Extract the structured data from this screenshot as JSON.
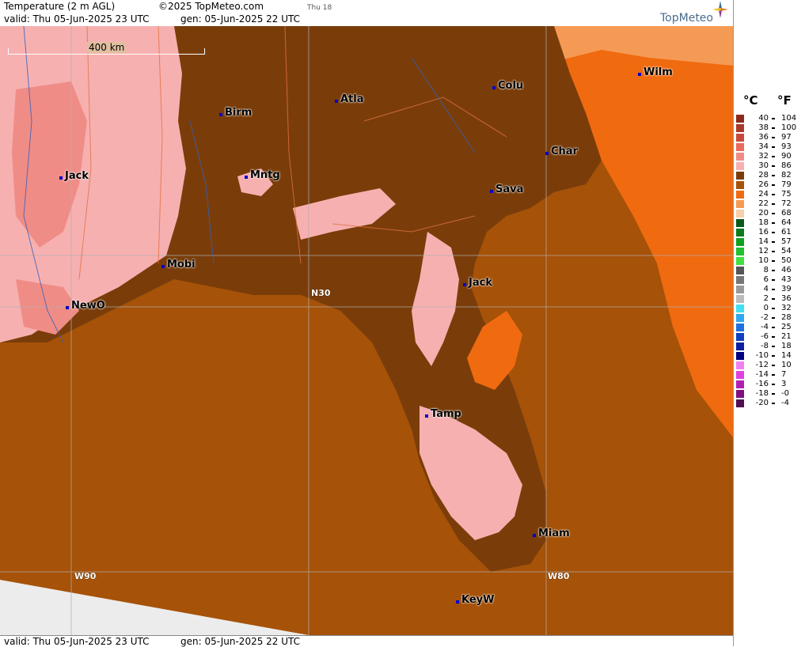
{
  "header": {
    "title": "Temperature (2 m AGL)",
    "copyright": "©2025 TopMeteo.com",
    "valid": "valid:  Thu  05-Jun-2025  23 UTC",
    "gen": "gen:  05-Jun-2025 22 UTC",
    "small": "Thu 18",
    "logo": "TopMeteo"
  },
  "footer": {
    "valid": "valid:  Thu  05-Jun-2025  23 UTC",
    "gen": "gen:  05-Jun-2025 22 UTC"
  },
  "scale": {
    "label": "400 km"
  },
  "grid_labels": {
    "lat30": "N30",
    "lon90": "W90",
    "lon80": "W80"
  },
  "cities": [
    {
      "name": "Birm"
    },
    {
      "name": "Atla"
    },
    {
      "name": "Colu"
    },
    {
      "name": "Wilm"
    },
    {
      "name": "Jack"
    },
    {
      "name": "Mntg"
    },
    {
      "name": "Char"
    },
    {
      "name": "Sava"
    },
    {
      "name": "Mobi"
    },
    {
      "name": "Jack"
    },
    {
      "name": "NewO"
    },
    {
      "name": "Tamp"
    },
    {
      "name": "Miam"
    },
    {
      "name": "KeyW"
    }
  ],
  "legend": {
    "celsius_unit": "°C",
    "fahrenheit_unit": "°F",
    "rows": [
      {
        "c": "40",
        "f": "104",
        "color": "#8b2a1a"
      },
      {
        "c": "38",
        "f": "100",
        "color": "#a83a2a"
      },
      {
        "c": "36",
        "f": "97",
        "color": "#c84a3a"
      },
      {
        "c": "34",
        "f": "93",
        "color": "#e86a5a"
      },
      {
        "c": "32",
        "f": "90",
        "color": "#f08c86"
      },
      {
        "c": "30",
        "f": "86",
        "color": "#f7b0b0"
      },
      {
        "c": "28",
        "f": "82",
        "color": "#7a3d0a"
      },
      {
        "c": "26",
        "f": "79",
        "color": "#a65208"
      },
      {
        "c": "24",
        "f": "75",
        "color": "#f06a10"
      },
      {
        "c": "22",
        "f": "72",
        "color": "#f59a55"
      },
      {
        "c": "20",
        "f": "68",
        "color": "#f7d0a8"
      },
      {
        "c": "18",
        "f": "64",
        "color": "#0a5a1a"
      },
      {
        "c": "16",
        "f": "61",
        "color": "#0a7a1e"
      },
      {
        "c": "14",
        "f": "57",
        "color": "#10a020"
      },
      {
        "c": "12",
        "f": "54",
        "color": "#20c030"
      },
      {
        "c": "10",
        "f": "50",
        "color": "#40e040"
      },
      {
        "c": "8",
        "f": "46",
        "color": "#555555"
      },
      {
        "c": "6",
        "f": "43",
        "color": "#777777"
      },
      {
        "c": "4",
        "f": "39",
        "color": "#999999"
      },
      {
        "c": "2",
        "f": "36",
        "color": "#bbbbbb"
      },
      {
        "c": "0",
        "f": "32",
        "color": "#40e0f0"
      },
      {
        "c": "-2",
        "f": "28",
        "color": "#30a8f0"
      },
      {
        "c": "-4",
        "f": "25",
        "color": "#2070e0"
      },
      {
        "c": "-6",
        "f": "21",
        "color": "#1040c0"
      },
      {
        "c": "-8",
        "f": "18",
        "color": "#0a20a0"
      },
      {
        "c": "-10",
        "f": "14",
        "color": "#000080"
      },
      {
        "c": "-12",
        "f": "10",
        "color": "#f080f0"
      },
      {
        "c": "-14",
        "f": "7",
        "color": "#e040e0"
      },
      {
        "c": "-16",
        "f": "3",
        "color": "#b020b0"
      },
      {
        "c": "-18",
        "f": "-0",
        "color": "#801080"
      },
      {
        "c": "-20",
        "f": "-4",
        "color": "#501050"
      }
    ]
  },
  "colors": {
    "sea": "#a65208",
    "land_dark": "#7a3d0a",
    "hot_pink": "#f7b0b0",
    "hotter": "#f08c86",
    "orange": "#f06a10",
    "light_orange": "#f59a55",
    "pale": "#f7d0a8",
    "green": "#0a5a1a",
    "grey": "#ececec"
  }
}
